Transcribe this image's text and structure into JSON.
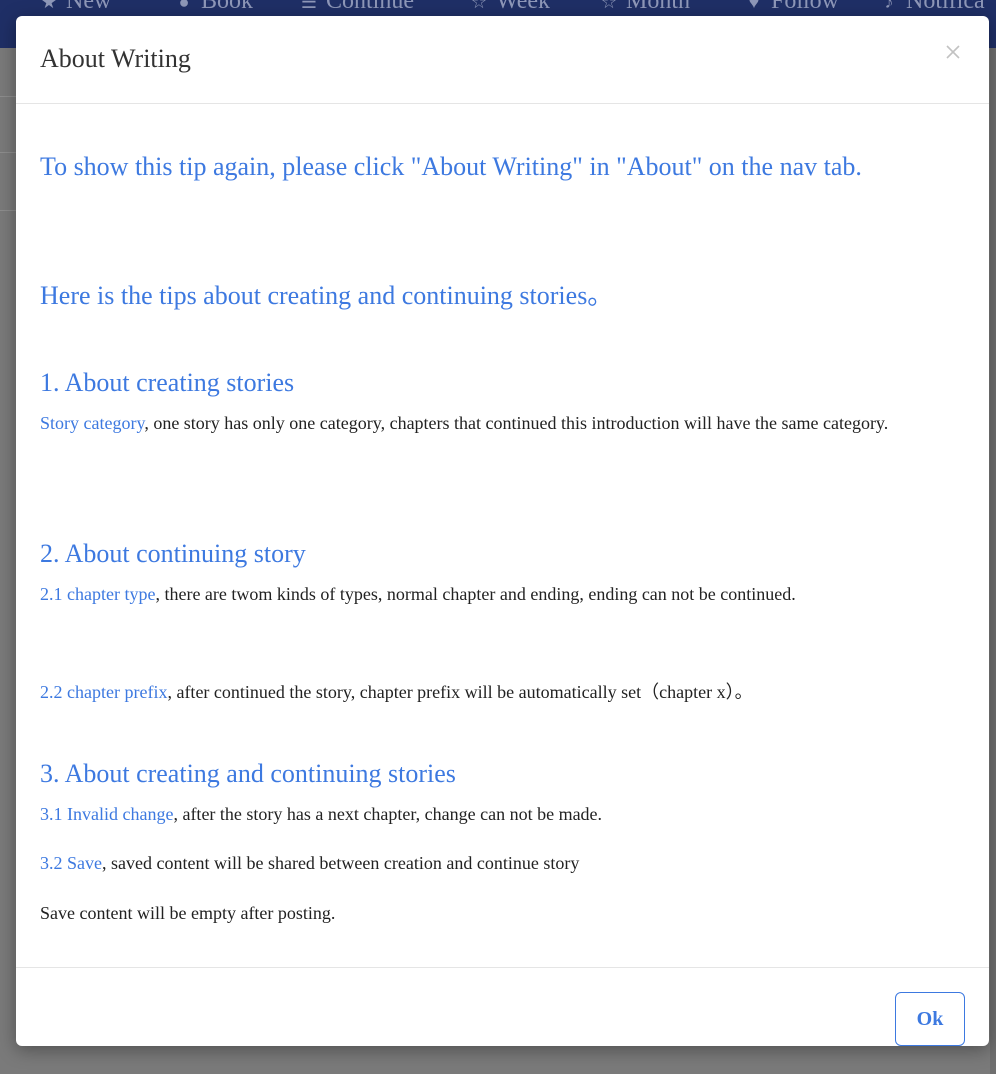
{
  "background_nav": {
    "items": [
      {
        "label": "New",
        "icon": "star-icon"
      },
      {
        "label": "Book",
        "icon": "user-icon"
      },
      {
        "label": "Continue",
        "icon": "list-icon"
      },
      {
        "label": "Week",
        "icon": "star-outline-icon"
      },
      {
        "label": "Month",
        "icon": "star-outline-icon"
      },
      {
        "label": "Follow",
        "icon": "heart-icon"
      },
      {
        "label": "Notifica",
        "icon": "bell-icon"
      }
    ]
  },
  "modal": {
    "title": "About Writing",
    "close_icon": "close-icon",
    "tip": "To show this tip again, please click \"About Writing\" in \"About\" on the nav tab.",
    "intro": "Here is the tips about creating and continuing stories。",
    "sections": [
      {
        "heading": "1. About creating stories",
        "items": [
          {
            "term": "Story category",
            "text": ", one story has only one category, chapters that continued this introduction will have the same category."
          }
        ]
      },
      {
        "heading": "2. About continuing story",
        "items": [
          {
            "term": "2.1 chapter type",
            "text": ", there are twom kinds of types, normal chapter and ending, ending can not be continued."
          },
          {
            "term": "2.2 chapter prefix",
            "text": ", after continued the story, chapter prefix will be automatically set（chapter x）。"
          }
        ]
      },
      {
        "heading": "3. About creating and continuing stories",
        "items": [
          {
            "term": "3.1 Invalid change",
            "text": ", after the story has a next chapter, change can not be made."
          },
          {
            "term": "3.2 Save",
            "text": ", saved content will be shared between creation and continue story"
          },
          {
            "term": "",
            "text": "Save content will be empty after posting."
          }
        ]
      }
    ],
    "ok_label": "Ok"
  },
  "colors": {
    "accent": "#3d79e0",
    "navbar": "#1f2f66",
    "overlay": "#7a7a7a"
  }
}
